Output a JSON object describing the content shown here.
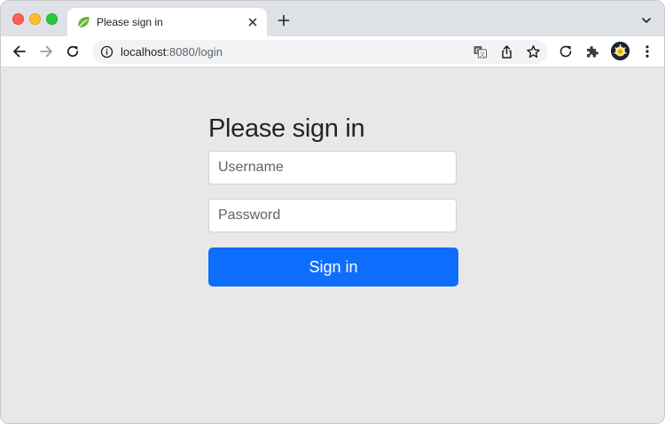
{
  "browser": {
    "tab": {
      "title": "Please sign in",
      "favicon": "spring-leaf-icon"
    },
    "address_bar": {
      "host": "localhost",
      "path": ":8080/login"
    },
    "colors": {
      "tabstrip": "#dee1e6",
      "toolbar": "#ffffff",
      "omnibox": "#f1f3f4",
      "traffic_red": "#ff5f57",
      "traffic_yellow": "#febc2e",
      "traffic_green": "#28c840"
    },
    "icons": [
      "back-arrow-icon",
      "forward-arrow-icon",
      "reload-icon",
      "site-info-icon",
      "translate-icon",
      "share-icon",
      "bookmark-star-icon",
      "extension-refresh-icon",
      "extensions-puzzle-icon",
      "profile-avatar",
      "more-menu-icon"
    ]
  },
  "login": {
    "heading": "Please sign in",
    "username_placeholder": "Username",
    "username_value": "",
    "password_placeholder": "Password",
    "password_value": "",
    "submit_label": "Sign in",
    "colors": {
      "page_background": "#e8e8e8",
      "primary_button": "#0d6efd",
      "heading_text": "#212529"
    }
  }
}
